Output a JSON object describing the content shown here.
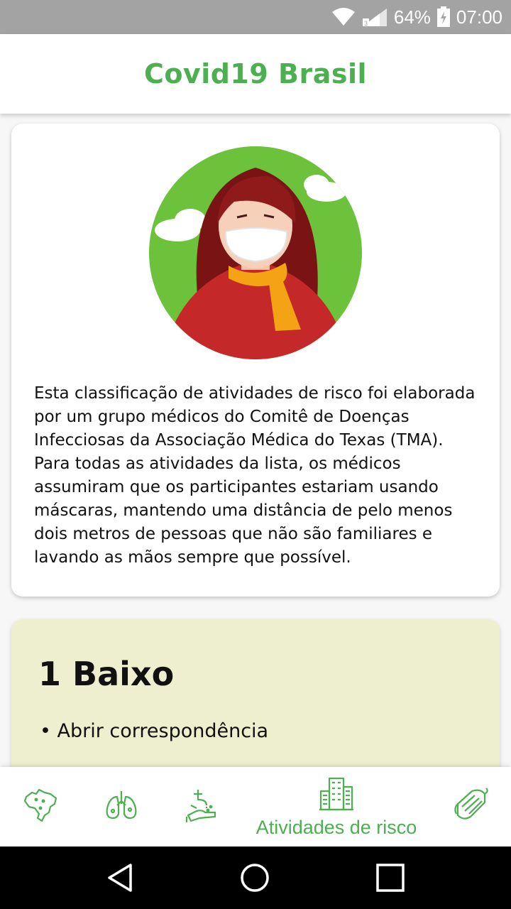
{
  "status_bar": {
    "battery": "64%",
    "time": "07:00",
    "icons": [
      "wifi-icon",
      "signal-icon",
      "battery-icon"
    ]
  },
  "app_bar": {
    "title": "Covid19 Brasil"
  },
  "intro_card": {
    "illustration": "woman-with-mask-illustration",
    "text": "Esta classificação de atividades de risco foi elaborada por um grupo médicos do Comitê de Doenças Infecciosas da Associação Médica do Texas (TMA). Para todas as atividades da lista, os médicos assumiram que os participantes estariam usando máscaras, mantendo uma distância de pelo menos dois metros de pessoas que não são familiares e lavando as mãos sempre que possível."
  },
  "risk_card": {
    "title": "1 Baixo",
    "items": [
      "• Abrir correspondência"
    ]
  },
  "bottom_nav": {
    "items": [
      {
        "icon": "brazil-map-icon",
        "label": ""
      },
      {
        "icon": "lungs-icon",
        "label": ""
      },
      {
        "icon": "hand-washing-icon",
        "label": ""
      },
      {
        "icon": "buildings-icon",
        "label": "Atividades de risco",
        "active": true
      },
      {
        "icon": "mask-icon",
        "label": ""
      }
    ]
  },
  "colors": {
    "accent": "#4caf50",
    "risk_low_bg": "#eeefcf",
    "status_bar": "#a3a3a3"
  }
}
